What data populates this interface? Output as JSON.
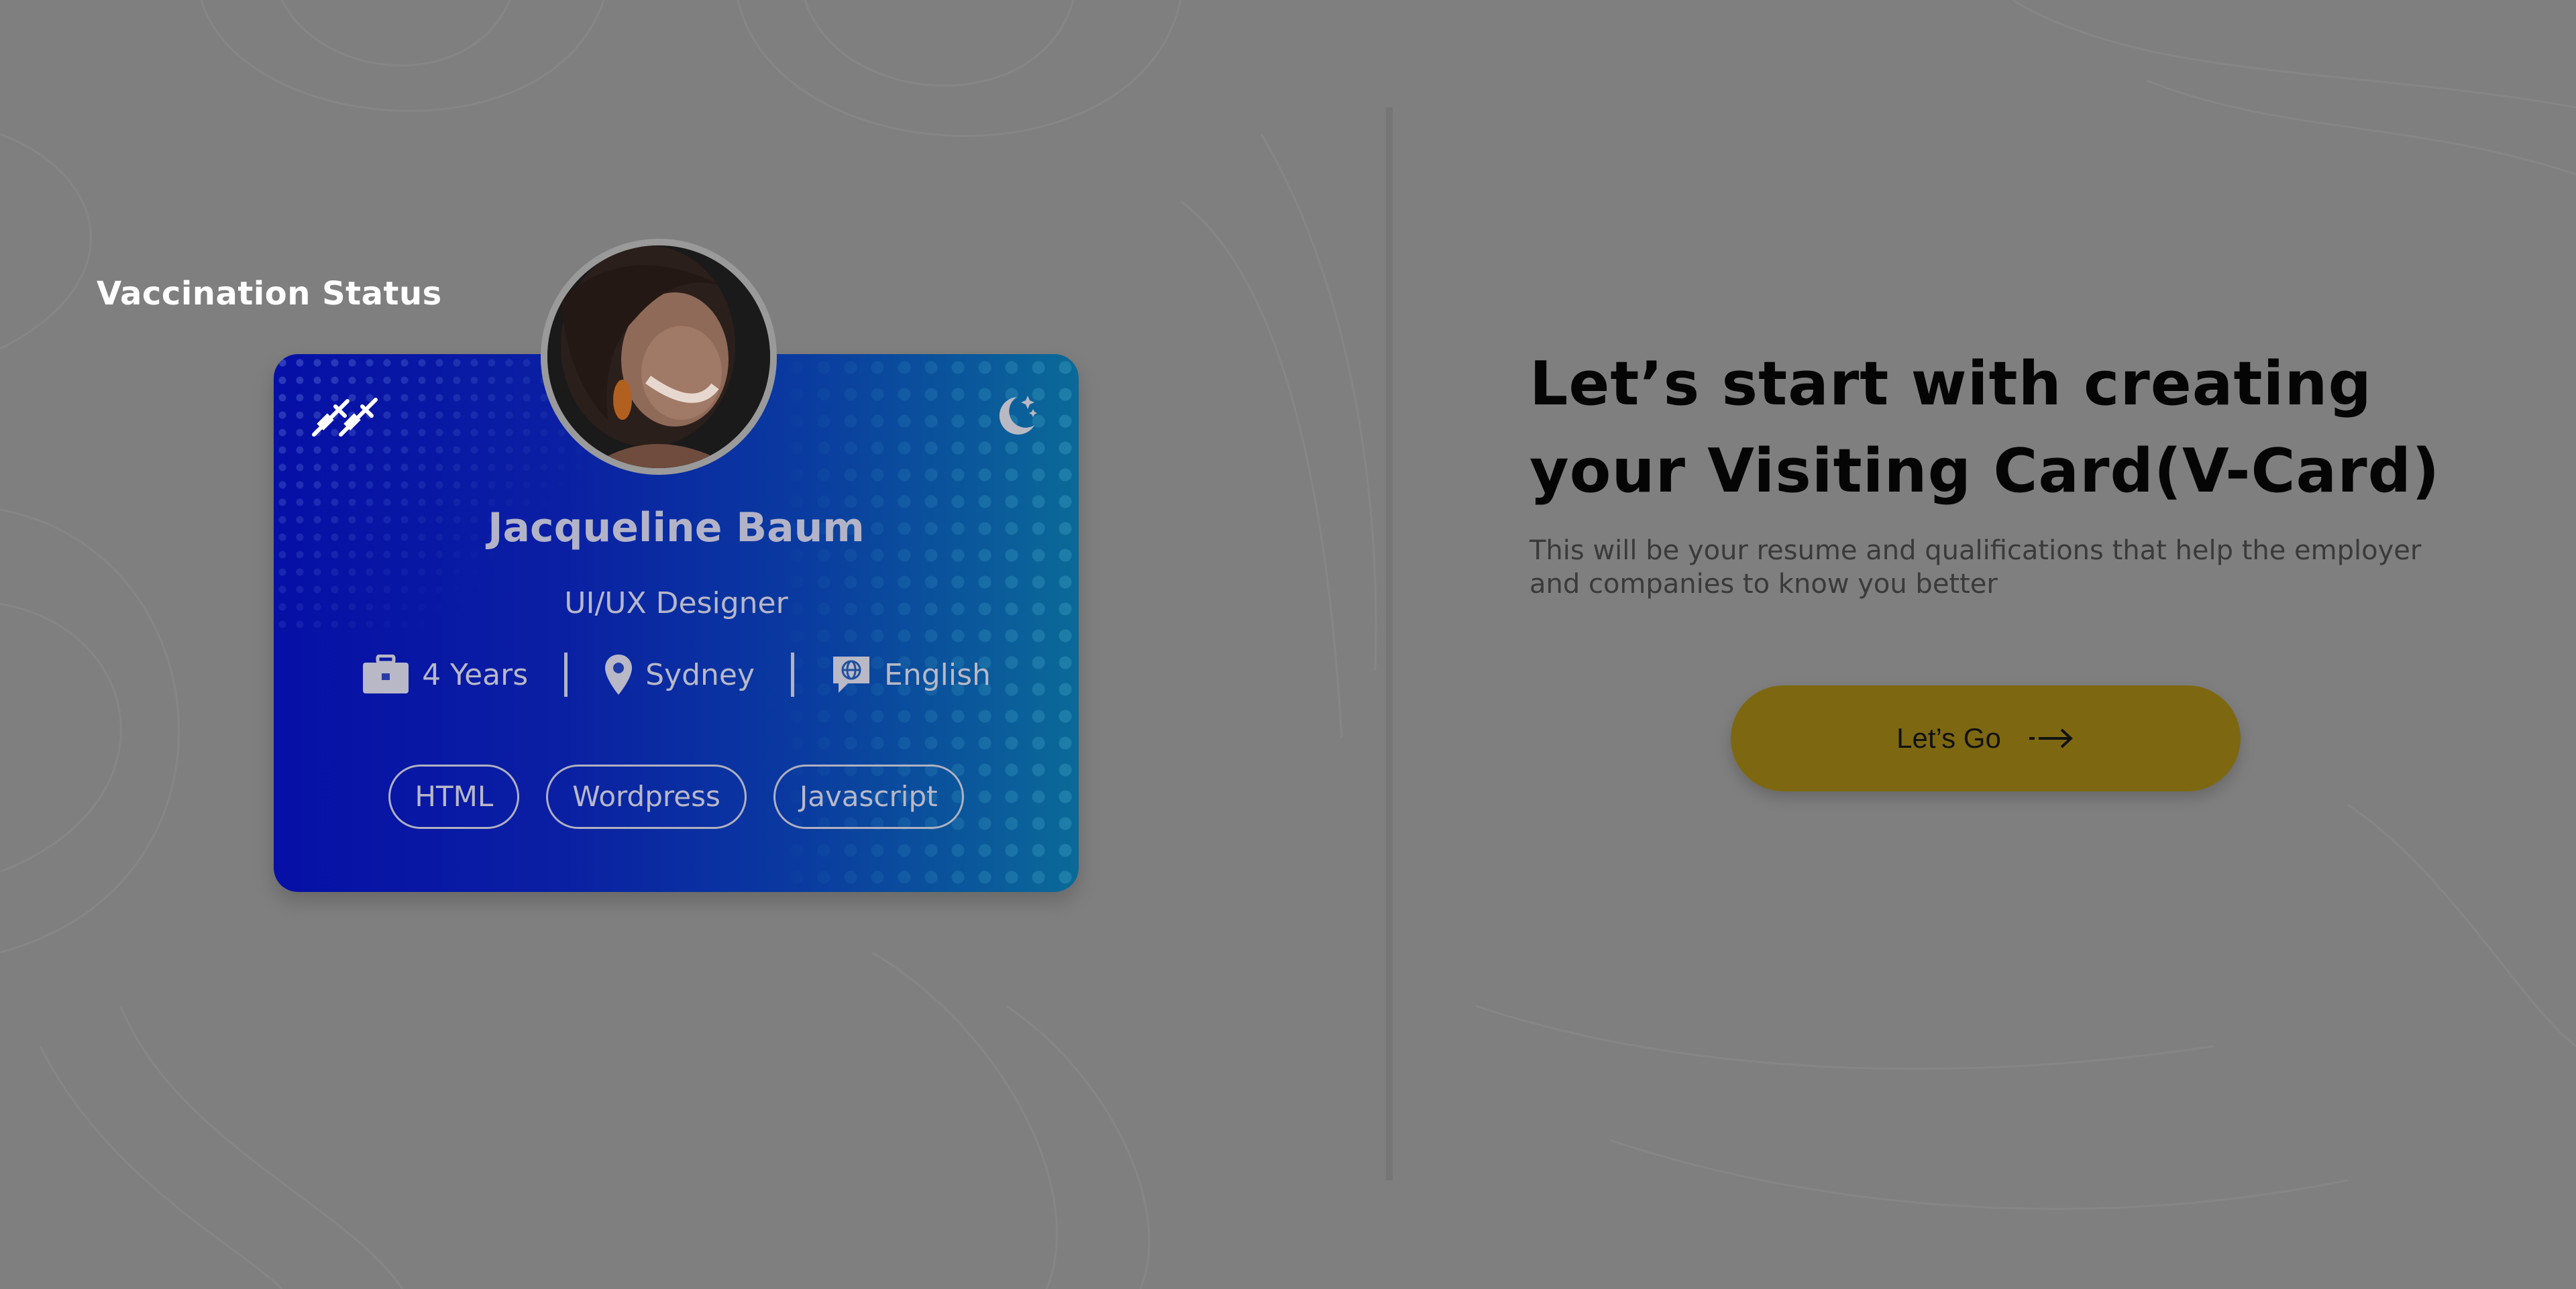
{
  "left_panel": {
    "label": "Vaccination Status"
  },
  "card": {
    "name": "Jacqueline Baum",
    "role": "UI/UX Designer",
    "experience": "4 Years",
    "location": "Sydney",
    "language": "English",
    "skills": [
      {
        "label": "HTML"
      },
      {
        "label": "Wordpress"
      },
      {
        "label": "Javascript"
      }
    ],
    "icons": {
      "vaccination": "syringe-icon",
      "theme": "moon-icon",
      "experience": "briefcase-icon",
      "location": "location-pin-icon",
      "language": "globe-chat-icon"
    }
  },
  "right_panel": {
    "headline_line1": "Let’s start with creating",
    "headline_line2": "your Visiting Card(V-Card)",
    "description": "This will be your resume and qualifications that help the employer and companies to know you better",
    "cta_label": "Let’s Go",
    "cta_icon": "arrow-right-icon"
  },
  "colors": {
    "overlay": "#7f7f7f",
    "card_gradient_start": "#060fa6",
    "card_gradient_end": "#0a6a98",
    "cta_button": "#7d6811",
    "headline": "#050505"
  }
}
